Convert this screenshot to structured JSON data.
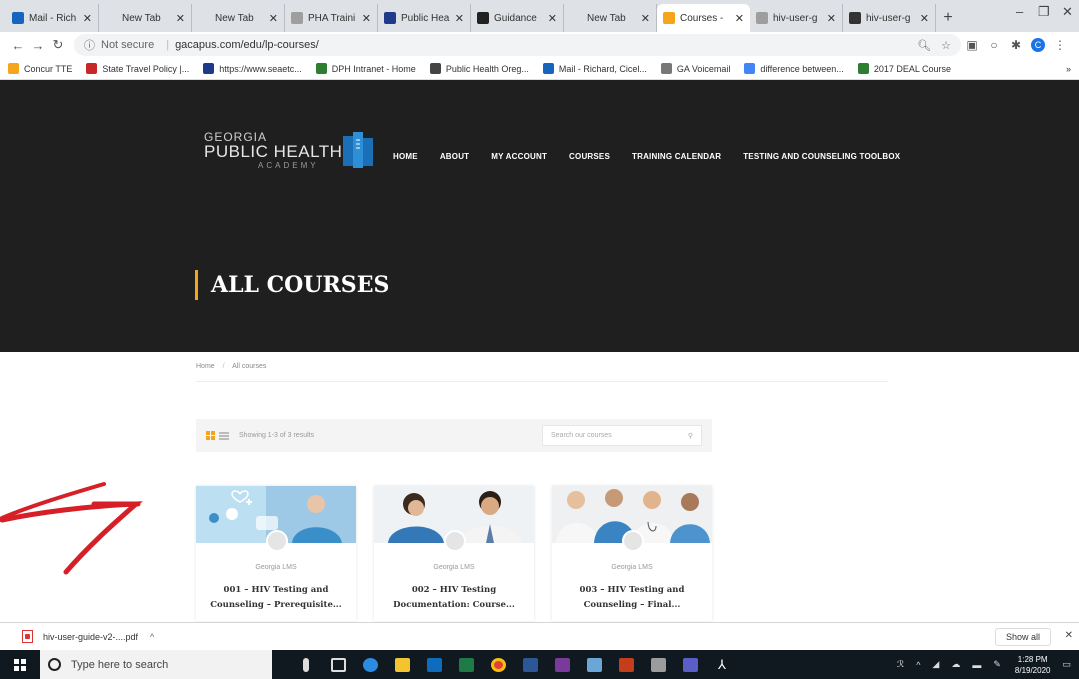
{
  "browser": {
    "tabs": [
      {
        "label": "Mail - Rich",
        "icon_color": "#1565c0",
        "active": false
      },
      {
        "label": "New Tab",
        "icon_color": "",
        "active": false
      },
      {
        "label": "New Tab",
        "icon_color": "",
        "active": false
      },
      {
        "label": "PHA Traini",
        "icon_color": "#9e9e9e",
        "active": false
      },
      {
        "label": "Public Hea",
        "icon_color": "#1e3a8a",
        "active": false
      },
      {
        "label": "Guidance",
        "icon_color": "#222222",
        "active": false
      },
      {
        "label": "New Tab",
        "icon_color": "",
        "active": false
      },
      {
        "label": "Courses -",
        "icon_color": "#f4a51c",
        "active": true
      },
      {
        "label": "hiv-user-g",
        "icon_color": "#9e9e9e",
        "active": false
      },
      {
        "label": "hiv-user-g",
        "icon_color": "#333333",
        "active": false
      }
    ],
    "new_tab": "+",
    "address": {
      "secure_label": "Not secure",
      "url": "gacapus.com/edu/lp-courses/"
    },
    "profile_letter": "C",
    "bookmarks": [
      {
        "label": "Concur TTE",
        "icon_color": "#f4a51c"
      },
      {
        "label": "State Travel Policy |...",
        "icon_color": "#c62828"
      },
      {
        "label": "https://www.seaetc...",
        "icon_color": "#1e3a8a"
      },
      {
        "label": "DPH Intranet - Home",
        "icon_color": "#2e7d32"
      },
      {
        "label": "Public Health Oreg...",
        "icon_color": "#444444"
      },
      {
        "label": "Mail - Richard, Cicel...",
        "icon_color": "#1565c0"
      },
      {
        "label": "GA Voicemail",
        "icon_color": "#777777"
      },
      {
        "label": "difference between...",
        "icon_color": "#4285f4"
      },
      {
        "label": "2017 DEAL Course",
        "icon_color": "#2e7d32"
      }
    ],
    "more_bookmarks": "»"
  },
  "site": {
    "logo": {
      "line1": "GEORGIA",
      "line2": "PUBLIC HEALTH",
      "line3": "ACADEMY"
    },
    "nav": [
      "HOME",
      "ABOUT",
      "MY ACCOUNT",
      "COURSES",
      "TRAINING CALENDAR",
      "TESTING AND COUNSELING TOOLBOX"
    ],
    "page_title": "ALL COURSES",
    "accent_color": "#f4a51c",
    "breadcrumb": {
      "home": "Home",
      "current": "All courses"
    },
    "results_text": "Showing 1-3 of 3 results",
    "search_placeholder": "Search our courses",
    "courses": [
      {
        "instructor": "Georgia LMS",
        "title": "001 – HIV Testing and Counseling – Prerequisite..."
      },
      {
        "instructor": "Georgia LMS",
        "title": "002 – HIV Testing Documentation: Course..."
      },
      {
        "instructor": "Georgia LMS",
        "title": "003 – HIV Testing and Counseling – Final..."
      }
    ]
  },
  "download_shelf": {
    "file": "hiv-user-guide-v2-....pdf",
    "show_all": "Show all"
  },
  "taskbar": {
    "search_placeholder": "Type here to search",
    "time": "1:28 PM",
    "date": "8/19/2020"
  }
}
